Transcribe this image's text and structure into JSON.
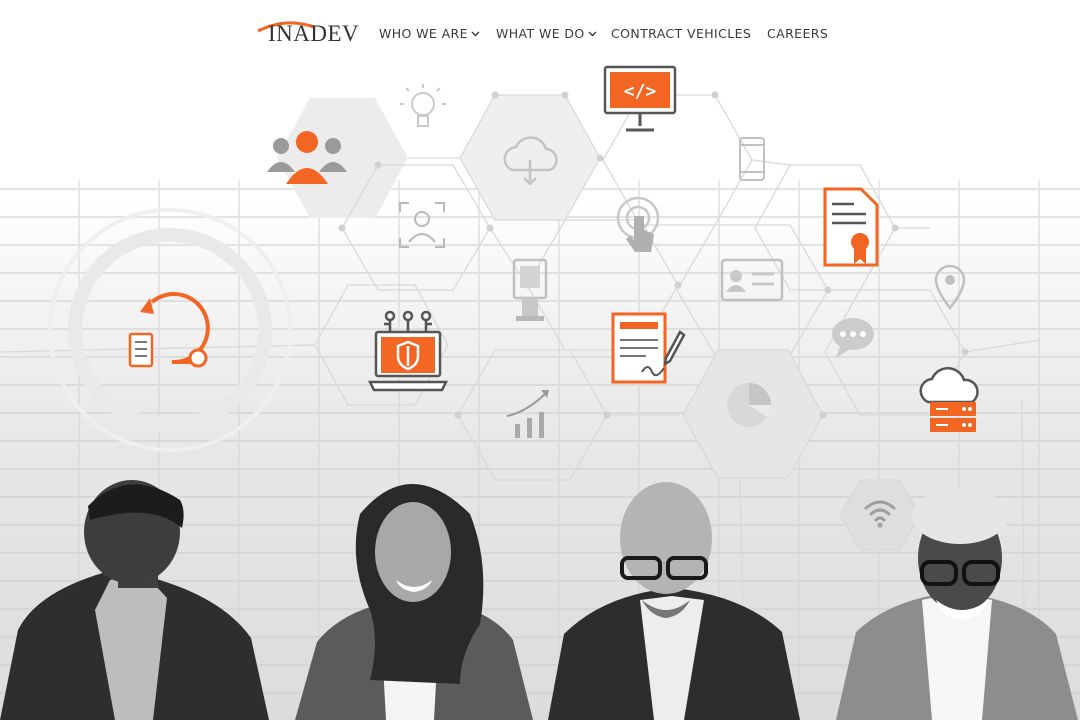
{
  "brand": {
    "logo_text": "INADEV",
    "accent_color": "#f26522"
  },
  "nav": {
    "items": [
      {
        "label": "WHO WE ARE",
        "dropdown": true
      },
      {
        "label": "WHAT WE DO",
        "dropdown": true
      },
      {
        "label": "CONTRACT VEHICLES",
        "dropdown": false
      },
      {
        "label": "CAREERS",
        "dropdown": false
      }
    ]
  },
  "hero": {
    "icons": [
      "users-icon",
      "lightbulb-icon",
      "cloud-download-icon",
      "code-monitor-icon",
      "face-scan-icon",
      "touch-icon",
      "smartphone-icon",
      "certificate-icon",
      "cycle-icon",
      "kiosk-icon",
      "shield-laptop-icon",
      "contract-sign-icon",
      "id-card-icon",
      "location-pin-icon",
      "chat-icon",
      "growth-chart-icon",
      "pie-chart-icon",
      "cloud-server-icon",
      "wifi-icon"
    ]
  }
}
